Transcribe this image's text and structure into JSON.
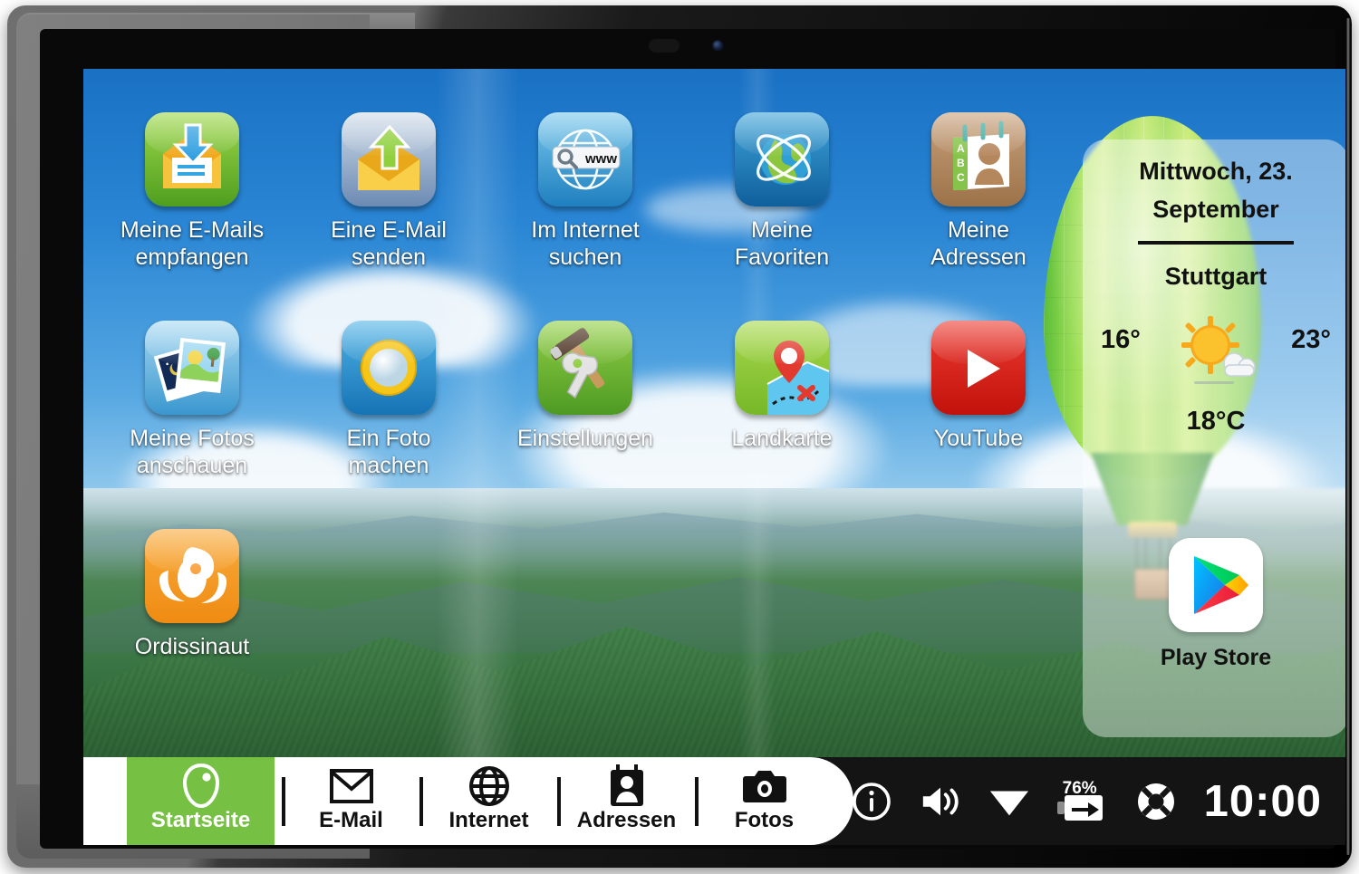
{
  "device": {
    "name": "tablet",
    "camera": "front-camera",
    "sensor": "light-sensor"
  },
  "home": {
    "apps": [
      {
        "label": "Meine E-Mails\nempfangen",
        "icon": "email-receive-icon",
        "line1": "Meine E-Mails",
        "line2": "empfangen"
      },
      {
        "label": "Eine E-Mail senden",
        "icon": "email-send-icon",
        "line1": "Eine E-Mail",
        "line2": "senden"
      },
      {
        "label": "Im Internet suchen",
        "icon": "internet-search-icon",
        "line1": "Im Internet",
        "line2": "suchen"
      },
      {
        "label": "Meine Favoriten",
        "icon": "favorites-globe-icon",
        "line1": "Meine",
        "line2": "Favoriten"
      },
      {
        "label": "Meine Adressen",
        "icon": "address-book-icon",
        "line1": "Meine",
        "line2": "Adressen"
      },
      {
        "label": "Meine Fotos anschauen",
        "icon": "photos-icon",
        "line1": "Meine Fotos",
        "line2": "anschauen"
      },
      {
        "label": "Ein Foto machen",
        "icon": "camera-icon",
        "line1": "Ein Foto",
        "line2": "machen"
      },
      {
        "label": "Einstellungen",
        "icon": "settings-tools-icon",
        "line1": "Einstellungen",
        "line2": ""
      },
      {
        "label": "Landkarte",
        "icon": "map-pin-icon",
        "line1": "Landkarte",
        "line2": ""
      },
      {
        "label": "YouTube",
        "icon": "youtube-icon",
        "line1": "YouTube",
        "line2": ""
      },
      {
        "label": "Ordissinaut",
        "icon": "ordissinaut-icon",
        "line1": "Ordissinaut",
        "line2": ""
      }
    ]
  },
  "weather_widget": {
    "date_line1": "Mittwoch, 23.",
    "date_line2": "September",
    "city": "Stuttgart",
    "temp_min": "16°",
    "temp_max": "23°",
    "current_temp": "18°C",
    "condition_icon": "sun-behind-cloud-icon"
  },
  "play_store": {
    "label": "Play Store",
    "icon": "play-store-icon"
  },
  "taskbar": {
    "items": [
      {
        "label": "Startseite",
        "icon": "home-leaf-icon",
        "active": true
      },
      {
        "label": "E-Mail",
        "icon": "envelope-icon",
        "active": false
      },
      {
        "label": "Internet",
        "icon": "globe-icon",
        "active": false
      },
      {
        "label": "Adressen",
        "icon": "contact-card-icon",
        "active": false
      },
      {
        "label": "Fotos",
        "icon": "camera-icon",
        "active": false
      }
    ],
    "active_color": "#76c043"
  },
  "status_bar": {
    "info_icon": "info-circle-icon",
    "volume_icon": "speaker-volume-icon",
    "wifi_icon": "wifi-icon",
    "battery_percent": "76%",
    "battery_icon": "battery-charging-icon",
    "help_icon": "lifebuoy-icon",
    "clock": "10:00"
  }
}
